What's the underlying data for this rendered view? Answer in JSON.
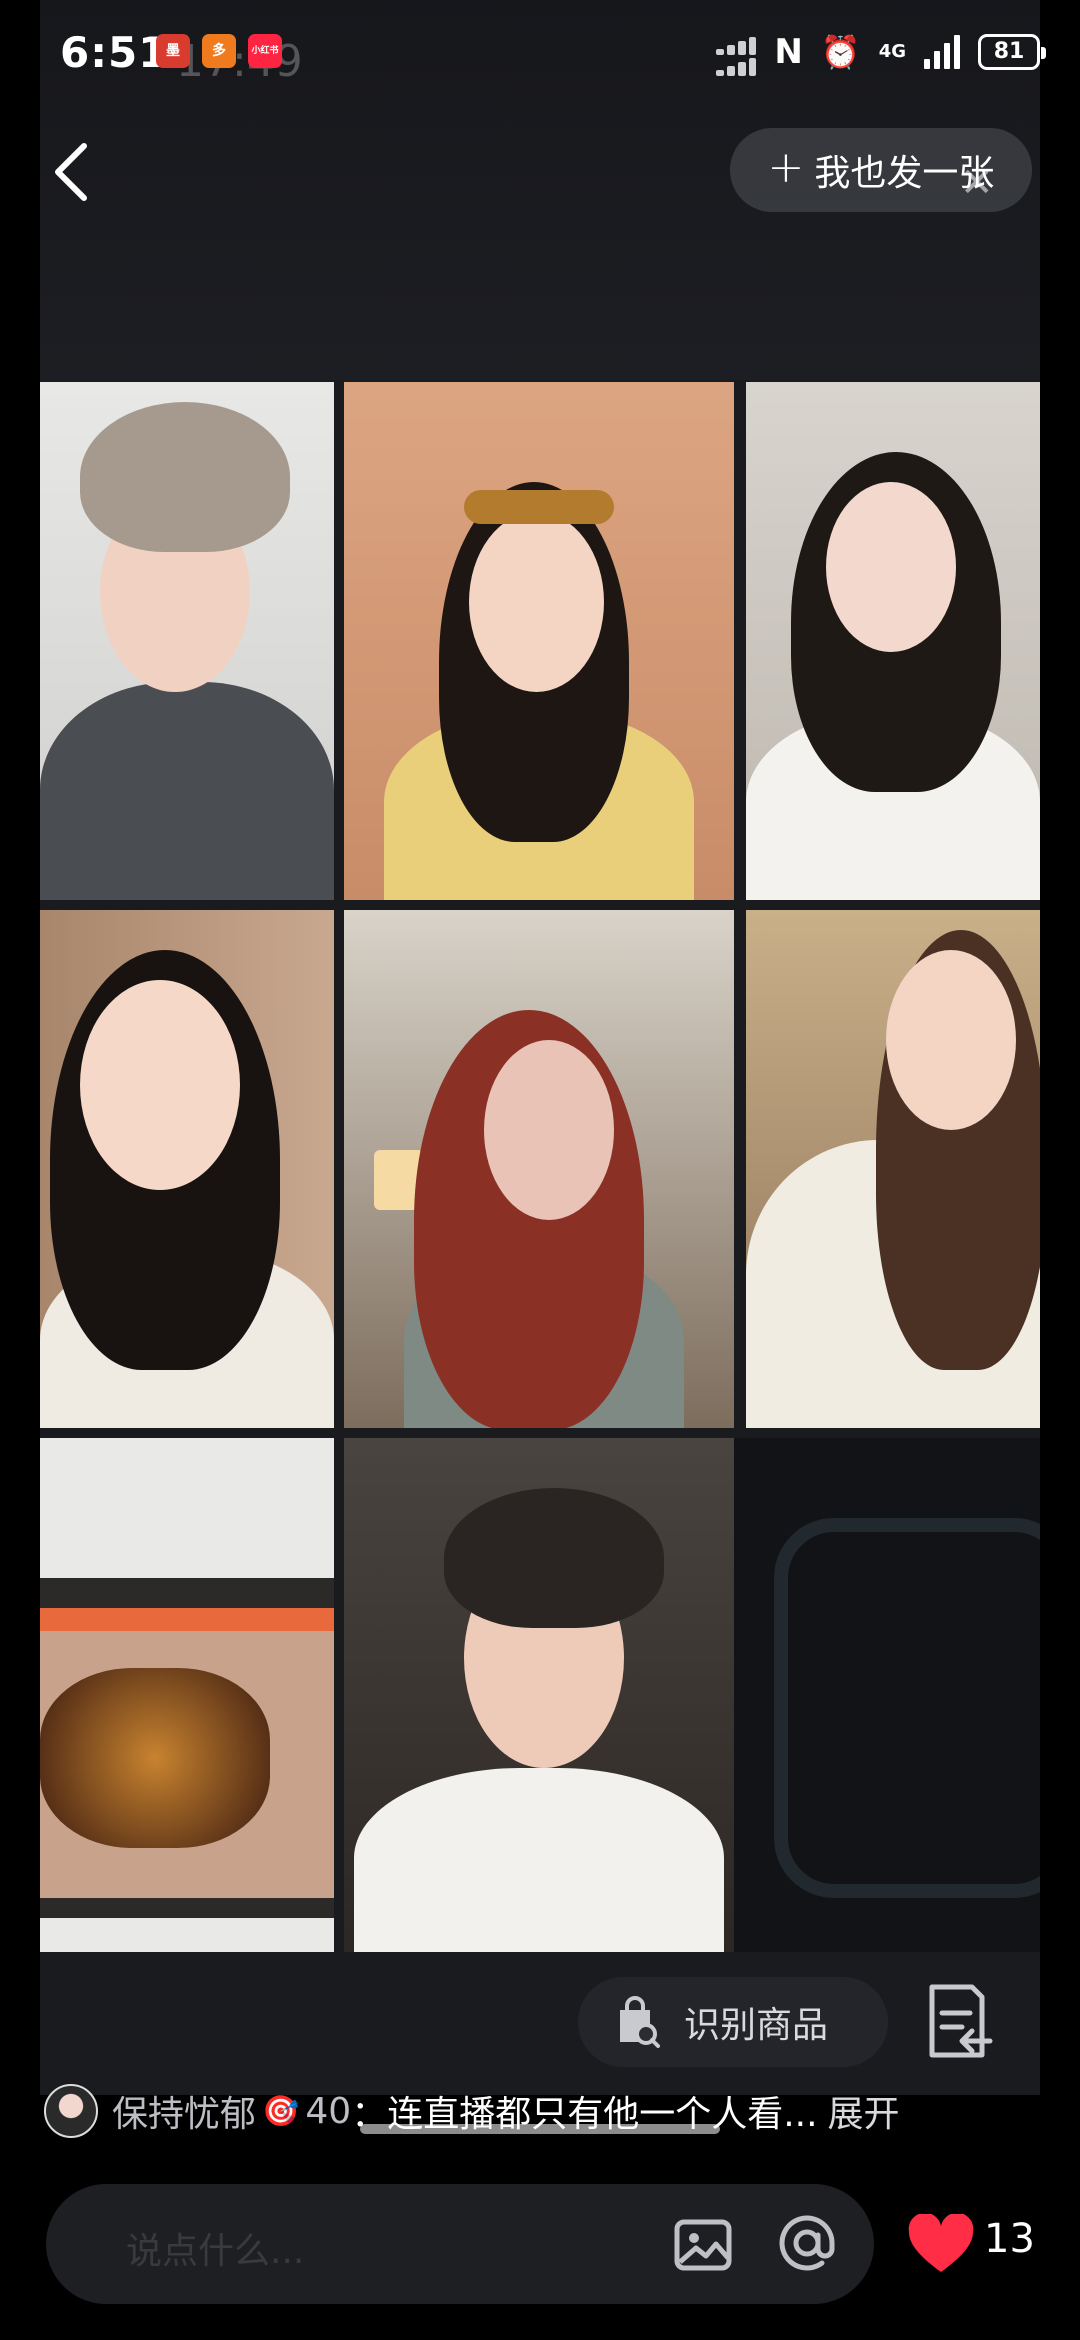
{
  "status_bar": {
    "time": "6:51",
    "ghost_time": "17:49",
    "notification_icons": [
      {
        "name": "red-app-icon",
        "label": "墨",
        "color": "#d93c2f"
      },
      {
        "name": "orange-app-icon",
        "label": "多",
        "color": "#f07a1e"
      },
      {
        "name": "xiaohongshu-app-icon",
        "label": "小红书",
        "color": "#ff2442"
      }
    ],
    "network": "4G",
    "battery": "81"
  },
  "header": {
    "post_too_label": "我也发一张"
  },
  "actions": {
    "recognize_product_label": "识别商品"
  },
  "caption": {
    "username": "保持忧郁",
    "level": "40",
    "separator": "：",
    "text": "连直播都只有他一个人看...",
    "expand_label": "展开"
  },
  "comment_bar": {
    "placeholder": "说点什么..."
  },
  "like": {
    "count": "13",
    "color": "#ff2d45"
  },
  "grid_tiles": [
    {
      "name": "livestream-tile-1"
    },
    {
      "name": "livestream-tile-2"
    },
    {
      "name": "livestream-tile-3"
    },
    {
      "name": "livestream-tile-4"
    },
    {
      "name": "livestream-tile-5"
    },
    {
      "name": "livestream-tile-6"
    },
    {
      "name": "livestream-tile-7"
    },
    {
      "name": "livestream-tile-8"
    }
  ]
}
